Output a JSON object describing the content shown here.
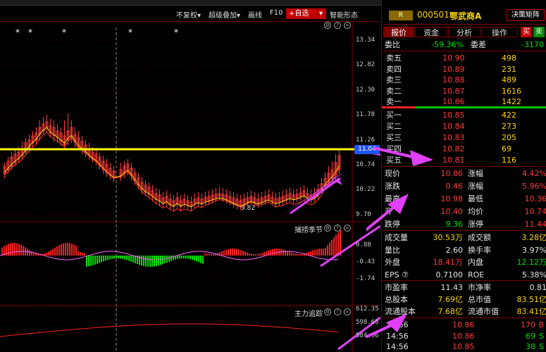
{
  "toolbar": {
    "fq": "不复权",
    "overlay": "超级叠加",
    "draw": "画线",
    "f10": "F10",
    "add_fav": "+自选",
    "smart": "智能形态"
  },
  "main_chart": {
    "stars": [
      "*",
      "*",
      "*",
      "*",
      "*"
    ],
    "yticks": [
      "13.34",
      "12.82",
      "12.30",
      "11.78",
      "11.26",
      "10.74",
      "10.22",
      "9.70"
    ],
    "current_price_tag": "11.04",
    "low_label": "9.82"
  },
  "sub1": {
    "name": "捕捞季节",
    "yticks": [
      "0.88",
      "-0.43",
      "-1.74"
    ]
  },
  "sub2": {
    "name": "主力追踪",
    "yticks": [
      "612.35",
      "598.65",
      "584.96"
    ]
  },
  "stock": {
    "r_badge": "R",
    "code": "000501",
    "name": "鄂武商A",
    "decision_btn": "决策矩阵"
  },
  "tabs": [
    "报价",
    "资金",
    "分析",
    "操作"
  ],
  "buy_sell_small": {
    "buy": "买",
    "sell": "卖"
  },
  "ratio": {
    "label1": "委比",
    "value1": "-59.36%",
    "label2": "委差",
    "value2": "-3170"
  },
  "asks": [
    {
      "label": "卖五",
      "price": "10.90",
      "vol": "498"
    },
    {
      "label": "卖四",
      "price": "10.89",
      "vol": "231"
    },
    {
      "label": "卖三",
      "price": "10.88",
      "vol": "489"
    },
    {
      "label": "卖二",
      "price": "10.87",
      "vol": "1616"
    },
    {
      "label": "卖一",
      "price": "10.86",
      "vol": "1422"
    }
  ],
  "bids": [
    {
      "label": "买一",
      "price": "10.85",
      "vol": "422"
    },
    {
      "label": "买二",
      "price": "10.84",
      "vol": "273"
    },
    {
      "label": "买三",
      "price": "10.83",
      "vol": "205"
    },
    {
      "label": "买四",
      "price": "10.82",
      "vol": "69"
    },
    {
      "label": "买五",
      "price": "10.81",
      "vol": "116"
    }
  ],
  "quote": [
    {
      "l1": "现价",
      "v1": "10.86",
      "l2": "涨幅",
      "v2": "4.42%"
    },
    {
      "l1": "涨跌",
      "v1": "0.46",
      "l2": "涨幅",
      "v2": "5.96%"
    },
    {
      "l1": "最高",
      "v1": "10.98",
      "l2": "最低",
      "v2": "10.36"
    },
    {
      "l1": "开",
      "v1": "10.40",
      "l2": "均价",
      "v2": "10.74"
    },
    {
      "l1": "跌停",
      "v1": "9.36",
      "l2": "涨停",
      "v2": "11.44"
    }
  ],
  "stats": [
    {
      "l1": "成交量",
      "v1": "30.53万",
      "l2": "成交额",
      "v2": "3.28亿"
    },
    {
      "l1": "量比",
      "v1": "2.60",
      "l2": "换手率",
      "v2": "3.97%"
    },
    {
      "l1": "外盘",
      "v1": "18.41万",
      "l2": "内盘",
      "v2": "12.12万"
    },
    {
      "l1": "EPS ⑦",
      "v1": "0.7100",
      "l2": "ROE",
      "v2": "5.38%"
    }
  ],
  "fund": [
    {
      "l1": "市盈率",
      "v1": "11.43",
      "l2": "市净率",
      "v2": "0.81"
    },
    {
      "l1": "总股本",
      "v1": "7.69亿",
      "l2": "总市值",
      "v2": "83.51亿"
    },
    {
      "l1": "流通股本",
      "v1": "7.68亿",
      "l2": "流通市值",
      "v2": "83.41亿"
    }
  ],
  "ticks": [
    {
      "time": "14:56",
      "price": "10.86",
      "vol": "170",
      "side": "B"
    },
    {
      "time": "14:56",
      "price": "10.86",
      "vol": "69",
      "side": "S"
    },
    {
      "time": "14:56",
      "price": "10.85",
      "vol": "38",
      "side": "S"
    }
  ],
  "colors": {
    "up": "#ff3b3b",
    "down": "#00e000",
    "yellow_line": "#ffff00",
    "arrow": "#e040fb",
    "accent": "#c40000"
  }
}
